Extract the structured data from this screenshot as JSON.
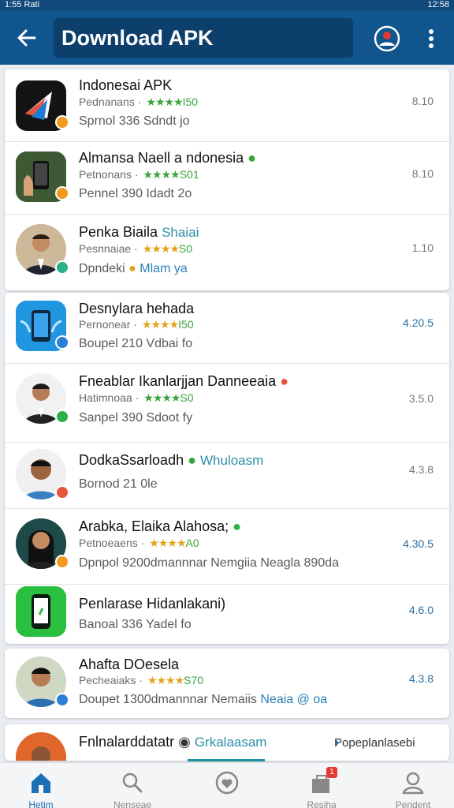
{
  "status_bar": {
    "left": "1:55 Rati",
    "right": "12:58"
  },
  "app_bar": {
    "title": "Download APK"
  },
  "apps": [
    {
      "name": "Indonesai APK",
      "rating_label": "Pednanans ·",
      "stars": "★★★★",
      "score": "I50",
      "sub": "Sprnol 336  Sdndt jo",
      "version": "8.10",
      "icon": "paper-plane-icon"
    },
    {
      "name": "Almansa Naell a ndonesia",
      "rating_label": "Petnonans ·",
      "stars": "★★★★",
      "score": "S01",
      "sub": "Pennel 390  Idadt 2o",
      "version": "8.10",
      "icon": "phone-in-hand-icon"
    },
    {
      "name": "Penka Biaila",
      "tag": "Shaiai",
      "rating_label": "Pesnnaiae ·",
      "stars": "★★★★",
      "score": "S0",
      "sub_left": "Dpndeki",
      "sub_right": "Mlam ya",
      "version": "1.10",
      "icon": "man-in-suit-icon"
    },
    {
      "name": "Desnylara hehada",
      "rating_label": "Pernonear ·",
      "stars": "★★★★",
      "score": "I50",
      "sub": "Boupel 210  Vdbai fo",
      "version": "4.20.5",
      "icon": "phone-app-icon"
    },
    {
      "name": "Fneablar Ikanlarjjan Danneeaia",
      "rating_label": "Hatimnoaa ·",
      "stars": "★★★★",
      "score": "S0",
      "sub": "Sanpel 390  Sdoot fy",
      "version": "3.5.0",
      "icon": "man-portrait-icon"
    },
    {
      "name": "DodkaSsarloadh",
      "tag": "Whuloasm",
      "sub": "Bornod 21  0le",
      "version": "4.3.8",
      "icon": "man-portrait-icon"
    },
    {
      "name": "Arabka, Elaika  Alahosa;",
      "rating_label": "Petnoeaens ·",
      "stars": "★★★★",
      "score": "A0",
      "sub": "Dpnpol 9200dmannnar Nemgiia Neagla 890da",
      "version": "4.30.5",
      "icon": "woman-portrait-icon"
    },
    {
      "name": "Penlarase Hidanlakani)",
      "sub": "Banoal 336  Yadel fo",
      "version": "4.6.0",
      "icon": "phone-app-icon"
    },
    {
      "name": "Ahafta DOesela",
      "rating_label": "Pecheaiaks ·",
      "stars": "★★★★",
      "score": "S70",
      "sub_left": "Doupet 1300dmannnar Nemaiis",
      "sub_right": "Neaia @ oa",
      "version": "4.3.8",
      "icon": "man-portrait-icon"
    },
    {
      "name": "Fnlnalarddatatr",
      "tag": "Grkalaasam",
      "icon": "person-portrait-icon"
    }
  ],
  "promo": {
    "label": "Popeplanlasebi",
    "chevron": "›"
  },
  "nav": [
    {
      "label": "Hetim",
      "icon": "home-icon"
    },
    {
      "label": "Nenseae",
      "icon": "search-icon"
    },
    {
      "label": "",
      "icon": "heart-shield-icon"
    },
    {
      "label": "Resiha",
      "icon": "apps-badge-icon"
    },
    {
      "label": "Pendent",
      "icon": "person-icon"
    }
  ],
  "nav_badge": "1",
  "colors": {
    "app_bar": "#11558f",
    "accent": "#1a6fb5",
    "star_green": "#3ba33b",
    "star_gold": "#e2a21a"
  }
}
